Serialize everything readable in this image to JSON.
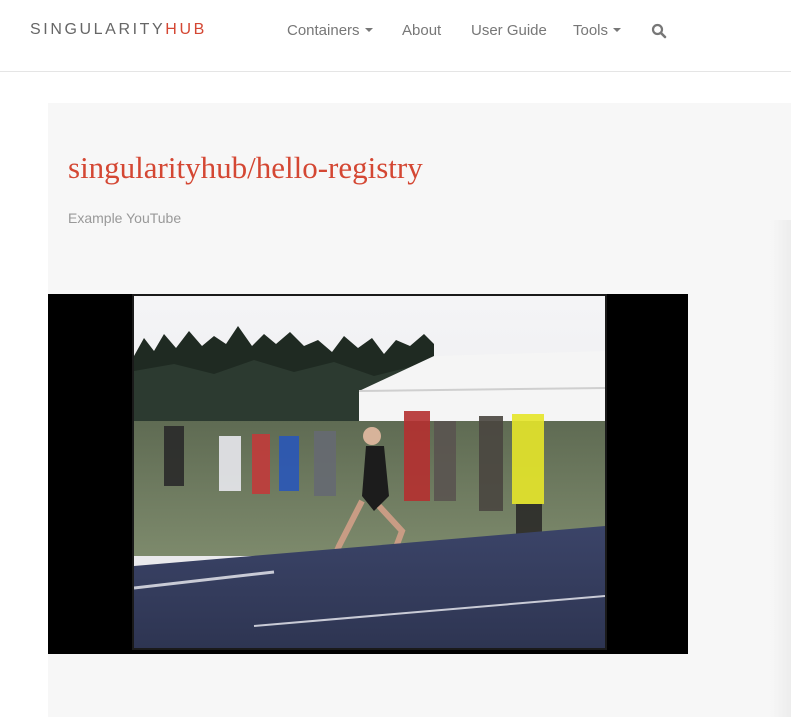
{
  "navbar": {
    "brand": {
      "part1": "SINGULARITY",
      "part2": "HUB"
    },
    "items": [
      {
        "label": "Containers",
        "dropdown": true
      },
      {
        "label": "About",
        "dropdown": false
      },
      {
        "label": "User Guide",
        "dropdown": false
      },
      {
        "label": "Tools",
        "dropdown": true
      }
    ],
    "search_icon": "search-icon"
  },
  "main": {
    "title": "singularityhub/hello-registry",
    "subtitle": "Example YouTube"
  },
  "video": {
    "content": "video-frame-track-runner"
  },
  "colors": {
    "accent": "#d44733",
    "nav_text": "#777777",
    "panel_bg": "#f7f7f7"
  }
}
